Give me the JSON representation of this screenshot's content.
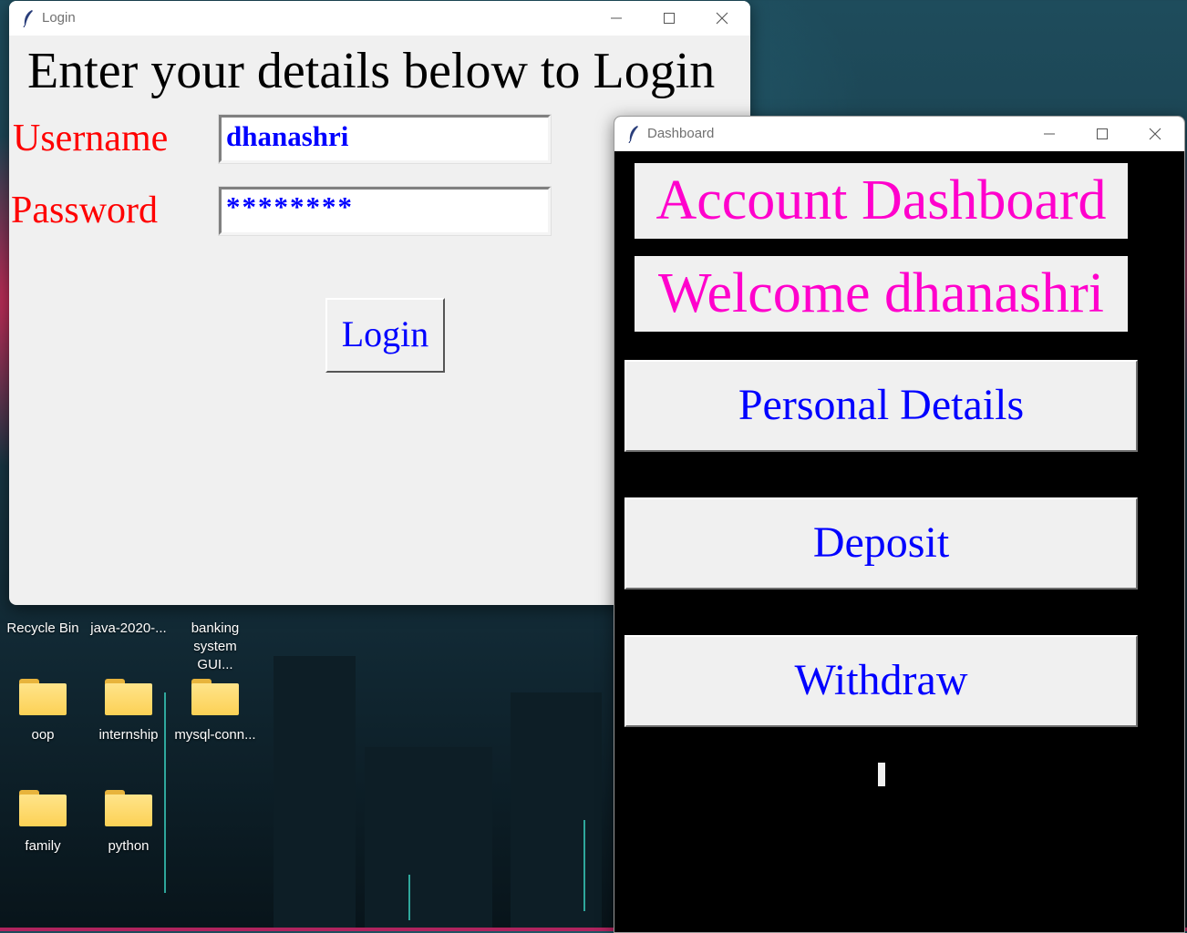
{
  "desktop": {
    "icons": [
      {
        "label": "Recycle Bin",
        "icon": "recycle-bin-icon"
      },
      {
        "label": "java-2020-...",
        "icon": "folder-icon"
      },
      {
        "label": "banking system GUI...",
        "icon": "folder-icon"
      },
      {
        "label": "oop",
        "icon": "folder-icon"
      },
      {
        "label": "internship",
        "icon": "folder-icon"
      },
      {
        "label": "mysql-conn...",
        "icon": "folder-icon"
      },
      {
        "label": "family",
        "icon": "folder-icon"
      },
      {
        "label": "python",
        "icon": "folder-icon"
      }
    ]
  },
  "login_window": {
    "title": "Login",
    "heading": "Enter your details below to Login",
    "username_label": "Username",
    "username_value": "dhanashri",
    "password_label": "Password",
    "password_value": "********",
    "login_button": "Login",
    "colors": {
      "label": "#ff0000",
      "entry_text": "#0000ff",
      "heading": "#000000"
    }
  },
  "dashboard_window": {
    "title": "Dashboard",
    "heading": "Account Dashboard",
    "welcome": "Welcome dhanashri",
    "buttons": {
      "personal_details": "Personal Details",
      "deposit": "Deposit",
      "withdraw": "Withdraw"
    },
    "colors": {
      "background": "#000000",
      "heading": "#ff00cc",
      "button_text": "#0000ff"
    }
  }
}
